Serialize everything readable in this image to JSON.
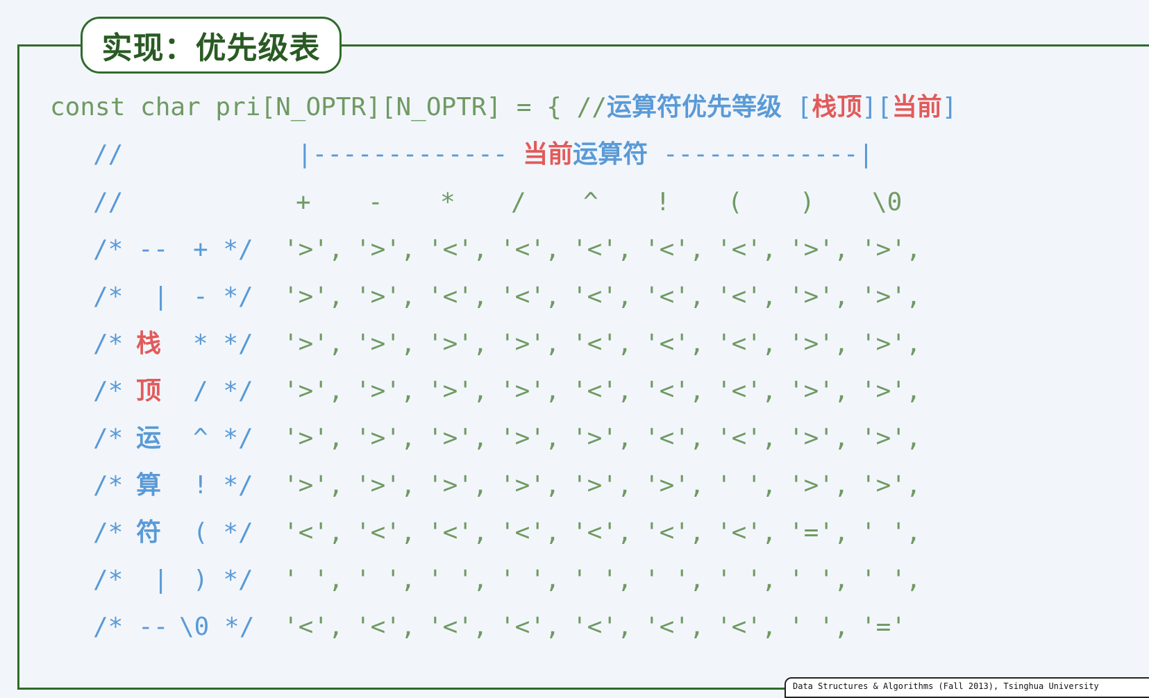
{
  "title": "实现：优先级表",
  "declaration": {
    "code": "const char pri[N_OPTR][N_OPTR] = { //",
    "comment_zh": "运算符优先等级",
    "bracket_open": "[",
    "stack_top": "栈顶",
    "bracket_mid": "][",
    "current": "当前",
    "bracket_close": "]"
  },
  "header_line": {
    "prefix": "//",
    "bar_left": "|-------------",
    "current_red": "当前",
    "operator_blue": "运算符",
    "bar_right": "-------------|"
  },
  "operators_header": {
    "prefix": "//",
    "ops": [
      "+",
      "-",
      "*",
      "/",
      "^",
      "!",
      "(",
      ")",
      "\\0"
    ]
  },
  "rows": [
    {
      "label_pre": "/* --",
      "label_zh": "",
      "label_op": "+ */",
      "cells": [
        "'>',",
        "'>',",
        "'<',",
        "'<',",
        "'<',",
        "'<',",
        "'<',",
        "'>',",
        "'>',"
      ]
    },
    {
      "label_pre": "/*  |",
      "label_zh": "",
      "label_op": "- */",
      "cells": [
        "'>',",
        "'>',",
        "'<',",
        "'<',",
        "'<',",
        "'<',",
        "'<',",
        "'>',",
        "'>',"
      ]
    },
    {
      "label_pre": "/*",
      "label_zh": "栈",
      "label_zh_color": "red",
      "label_op": "* */",
      "cells": [
        "'>',",
        "'>',",
        "'>',",
        "'>',",
        "'<',",
        "'<',",
        "'<',",
        "'>',",
        "'>',"
      ]
    },
    {
      "label_pre": "/*",
      "label_zh": "顶",
      "label_zh_color": "red",
      "label_op": "/ */",
      "cells": [
        "'>',",
        "'>',",
        "'>',",
        "'>',",
        "'<',",
        "'<',",
        "'<',",
        "'>',",
        "'>',"
      ]
    },
    {
      "label_pre": "/*",
      "label_zh": "运",
      "label_zh_color": "blue",
      "label_op": "^ */",
      "cells": [
        "'>',",
        "'>',",
        "'>',",
        "'>',",
        "'>',",
        "'<',",
        "'<',",
        "'>',",
        "'>',"
      ]
    },
    {
      "label_pre": "/*",
      "label_zh": "算",
      "label_zh_color": "blue",
      "label_op": "! */",
      "cells": [
        "'>',",
        "'>',",
        "'>',",
        "'>',",
        "'>',",
        "'>',",
        "' ',",
        "'>',",
        "'>',"
      ]
    },
    {
      "label_pre": "/*",
      "label_zh": "符",
      "label_zh_color": "blue",
      "label_op": "( */",
      "cells": [
        "'<',",
        "'<',",
        "'<',",
        "'<',",
        "'<',",
        "'<',",
        "'<',",
        "'=',",
        "' ',"
      ]
    },
    {
      "label_pre": "/*  |",
      "label_zh": "",
      "label_op": ") */",
      "cells": [
        "' ',",
        "' ',",
        "' ',",
        "' ',",
        "' ',",
        "' ',",
        "' ',",
        "' ',",
        "' ',"
      ]
    },
    {
      "label_pre": "/* --",
      "label_zh": "",
      "label_op": "\\0 */",
      "cells": [
        "'<',",
        "'<',",
        "'<',",
        "'<',",
        "'<',",
        "'<',",
        "'<',",
        "' ',",
        "'='"
      ]
    }
  ],
  "footer": "Data Structures & Algorithms (Fall 2013), Tsinghua University"
}
